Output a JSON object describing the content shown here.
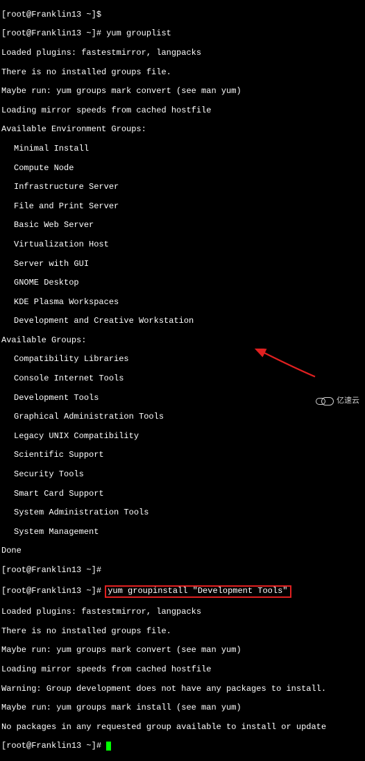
{
  "prompt_prefix": "[root@Franklin13 ~]# ",
  "user_prompt": "[root@Franklin13 ~]$",
  "commands": {
    "grouplist": "yum grouplist",
    "groupinstall": "yum groupinstall \"Development Tools\""
  },
  "output": {
    "loaded_plugins": "Loaded plugins: fastestmirror, langpacks",
    "no_groups_file": "There is no installed groups file.",
    "maybe_convert": "Maybe run: yum groups mark convert (see man yum)",
    "loading_mirror": "Loading mirror speeds from cached hostfile",
    "avail_env_header": "Available Environment Groups:",
    "env_groups": [
      "Minimal Install",
      "Compute Node",
      "Infrastructure Server",
      "File and Print Server",
      "Basic Web Server",
      "Virtualization Host",
      "Server with GUI",
      "GNOME Desktop",
      "KDE Plasma Workspaces",
      "Development and Creative Workstation"
    ],
    "avail_groups_header": "Available Groups:",
    "groups": [
      "Compatibility Libraries",
      "Console Internet Tools",
      "Development Tools",
      "Graphical Administration Tools",
      "Legacy UNIX Compatibility",
      "Scientific Support",
      "Security Tools",
      "Smart Card Support",
      "System Administration Tools",
      "System Management"
    ],
    "done": "Done",
    "warning": "Warning: Group development does not have any packages to install.",
    "maybe_install": "Maybe run: yum groups mark install (see man yum)",
    "no_packages": "No packages in any requested group available to install or update"
  },
  "watermark": "亿速云"
}
